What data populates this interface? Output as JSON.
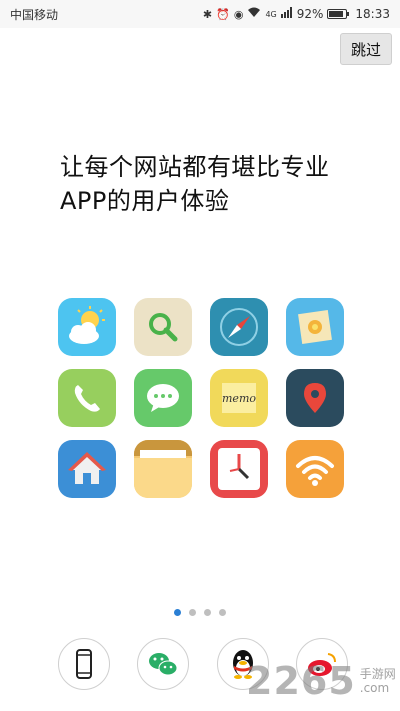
{
  "status_bar": {
    "carrier": "中国移动",
    "signal": "4G",
    "battery": "92%",
    "time": "18:33"
  },
  "skip_label": "跳过",
  "headline": "让每个网站都有堪比专业APP的用户体验",
  "memo_text": "memo",
  "pager": {
    "count": 4,
    "active_index": 0
  },
  "icons": [
    "weather-icon",
    "search-icon",
    "compass-icon",
    "photos-icon",
    "phone-icon",
    "messages-icon",
    "memo-icon",
    "map-pin-icon",
    "home-icon",
    "folder-icon",
    "clock-icon",
    "wifi-icon"
  ],
  "login_options": [
    "phone-login-icon",
    "wechat-login-icon",
    "qq-login-icon",
    "weibo-login-icon"
  ],
  "watermark": {
    "number": "2265",
    "text": "手游网",
    "sub": ".com"
  }
}
